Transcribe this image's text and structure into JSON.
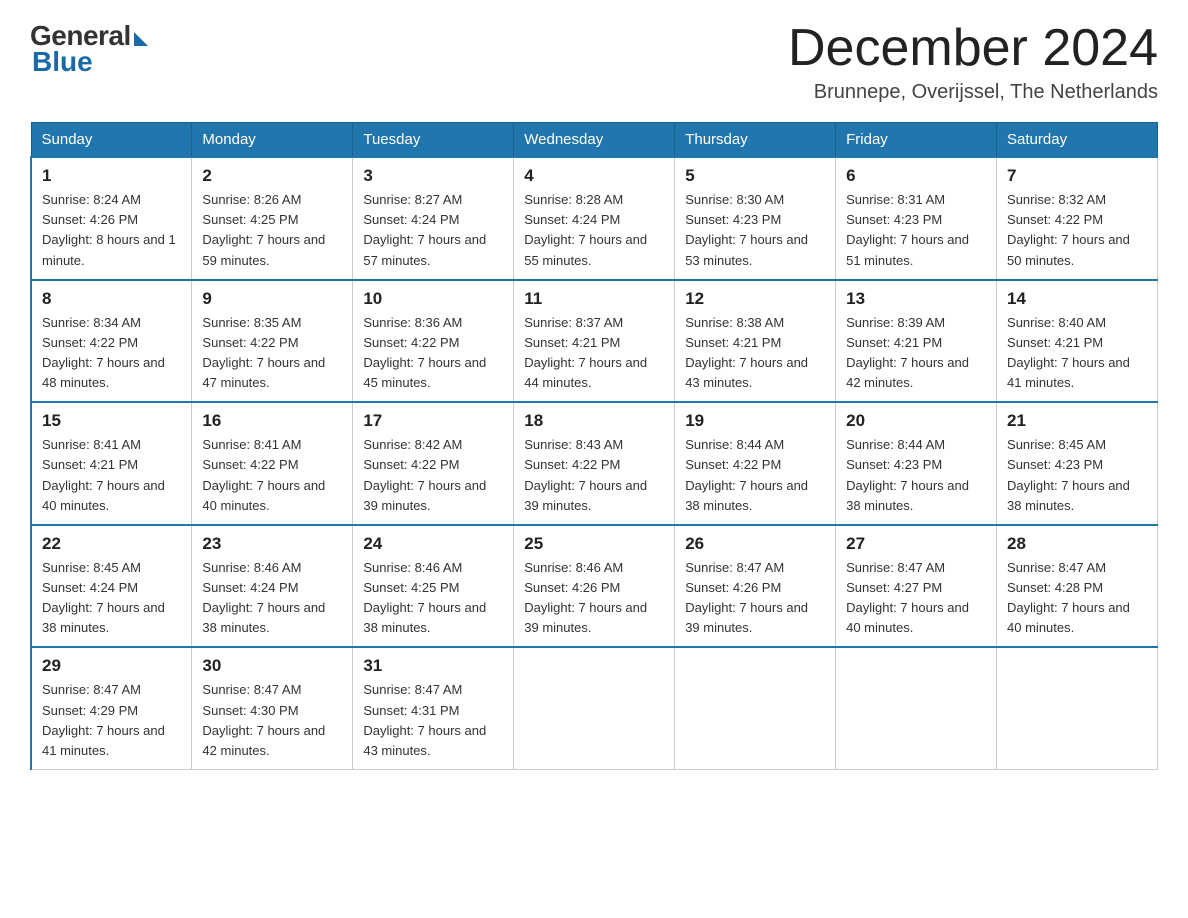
{
  "header": {
    "logo_general": "General",
    "logo_blue": "Blue",
    "title": "December 2024",
    "location": "Brunnepe, Overijssel, The Netherlands"
  },
  "days_of_week": [
    "Sunday",
    "Monday",
    "Tuesday",
    "Wednesday",
    "Thursday",
    "Friday",
    "Saturday"
  ],
  "weeks": [
    [
      {
        "day": "1",
        "sunrise": "8:24 AM",
        "sunset": "4:26 PM",
        "daylight": "8 hours and 1 minute."
      },
      {
        "day": "2",
        "sunrise": "8:26 AM",
        "sunset": "4:25 PM",
        "daylight": "7 hours and 59 minutes."
      },
      {
        "day": "3",
        "sunrise": "8:27 AM",
        "sunset": "4:24 PM",
        "daylight": "7 hours and 57 minutes."
      },
      {
        "day": "4",
        "sunrise": "8:28 AM",
        "sunset": "4:24 PM",
        "daylight": "7 hours and 55 minutes."
      },
      {
        "day": "5",
        "sunrise": "8:30 AM",
        "sunset": "4:23 PM",
        "daylight": "7 hours and 53 minutes."
      },
      {
        "day": "6",
        "sunrise": "8:31 AM",
        "sunset": "4:23 PM",
        "daylight": "7 hours and 51 minutes."
      },
      {
        "day": "7",
        "sunrise": "8:32 AM",
        "sunset": "4:22 PM",
        "daylight": "7 hours and 50 minutes."
      }
    ],
    [
      {
        "day": "8",
        "sunrise": "8:34 AM",
        "sunset": "4:22 PM",
        "daylight": "7 hours and 48 minutes."
      },
      {
        "day": "9",
        "sunrise": "8:35 AM",
        "sunset": "4:22 PM",
        "daylight": "7 hours and 47 minutes."
      },
      {
        "day": "10",
        "sunrise": "8:36 AM",
        "sunset": "4:22 PM",
        "daylight": "7 hours and 45 minutes."
      },
      {
        "day": "11",
        "sunrise": "8:37 AM",
        "sunset": "4:21 PM",
        "daylight": "7 hours and 44 minutes."
      },
      {
        "day": "12",
        "sunrise": "8:38 AM",
        "sunset": "4:21 PM",
        "daylight": "7 hours and 43 minutes."
      },
      {
        "day": "13",
        "sunrise": "8:39 AM",
        "sunset": "4:21 PM",
        "daylight": "7 hours and 42 minutes."
      },
      {
        "day": "14",
        "sunrise": "8:40 AM",
        "sunset": "4:21 PM",
        "daylight": "7 hours and 41 minutes."
      }
    ],
    [
      {
        "day": "15",
        "sunrise": "8:41 AM",
        "sunset": "4:21 PM",
        "daylight": "7 hours and 40 minutes."
      },
      {
        "day": "16",
        "sunrise": "8:41 AM",
        "sunset": "4:22 PM",
        "daylight": "7 hours and 40 minutes."
      },
      {
        "day": "17",
        "sunrise": "8:42 AM",
        "sunset": "4:22 PM",
        "daylight": "7 hours and 39 minutes."
      },
      {
        "day": "18",
        "sunrise": "8:43 AM",
        "sunset": "4:22 PM",
        "daylight": "7 hours and 39 minutes."
      },
      {
        "day": "19",
        "sunrise": "8:44 AM",
        "sunset": "4:22 PM",
        "daylight": "7 hours and 38 minutes."
      },
      {
        "day": "20",
        "sunrise": "8:44 AM",
        "sunset": "4:23 PM",
        "daylight": "7 hours and 38 minutes."
      },
      {
        "day": "21",
        "sunrise": "8:45 AM",
        "sunset": "4:23 PM",
        "daylight": "7 hours and 38 minutes."
      }
    ],
    [
      {
        "day": "22",
        "sunrise": "8:45 AM",
        "sunset": "4:24 PM",
        "daylight": "7 hours and 38 minutes."
      },
      {
        "day": "23",
        "sunrise": "8:46 AM",
        "sunset": "4:24 PM",
        "daylight": "7 hours and 38 minutes."
      },
      {
        "day": "24",
        "sunrise": "8:46 AM",
        "sunset": "4:25 PM",
        "daylight": "7 hours and 38 minutes."
      },
      {
        "day": "25",
        "sunrise": "8:46 AM",
        "sunset": "4:26 PM",
        "daylight": "7 hours and 39 minutes."
      },
      {
        "day": "26",
        "sunrise": "8:47 AM",
        "sunset": "4:26 PM",
        "daylight": "7 hours and 39 minutes."
      },
      {
        "day": "27",
        "sunrise": "8:47 AM",
        "sunset": "4:27 PM",
        "daylight": "7 hours and 40 minutes."
      },
      {
        "day": "28",
        "sunrise": "8:47 AM",
        "sunset": "4:28 PM",
        "daylight": "7 hours and 40 minutes."
      }
    ],
    [
      {
        "day": "29",
        "sunrise": "8:47 AM",
        "sunset": "4:29 PM",
        "daylight": "7 hours and 41 minutes."
      },
      {
        "day": "30",
        "sunrise": "8:47 AM",
        "sunset": "4:30 PM",
        "daylight": "7 hours and 42 minutes."
      },
      {
        "day": "31",
        "sunrise": "8:47 AM",
        "sunset": "4:31 PM",
        "daylight": "7 hours and 43 minutes."
      },
      null,
      null,
      null,
      null
    ]
  ]
}
